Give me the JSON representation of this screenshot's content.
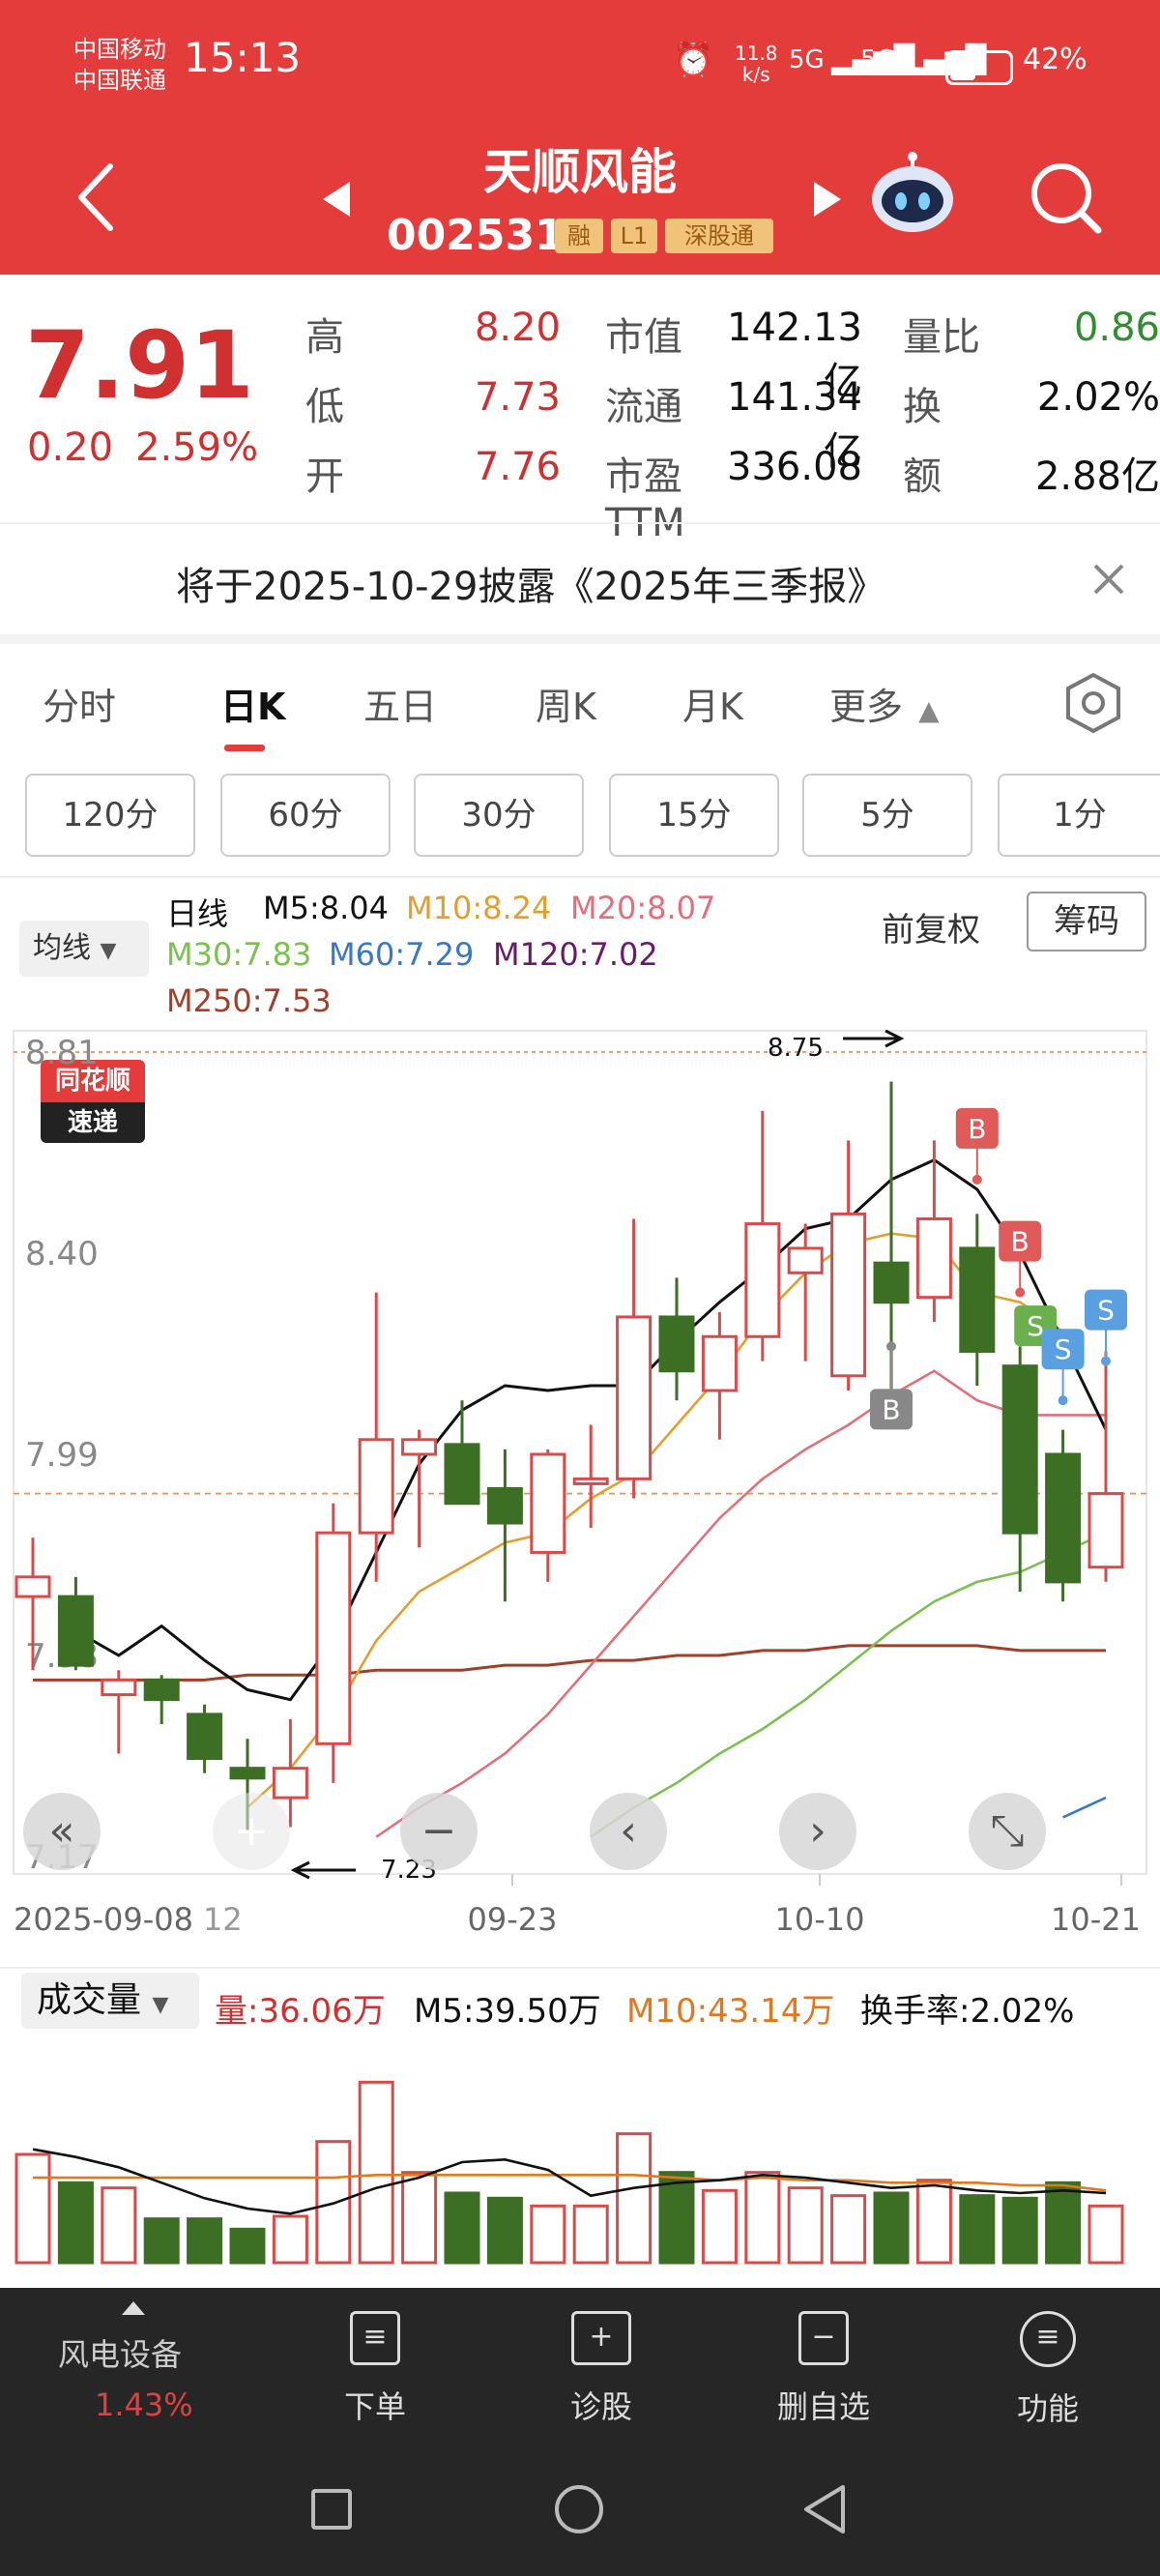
{
  "status_bar": {
    "carrier1": "中国移动",
    "carrier2": "中国联通",
    "time": "15:13",
    "net_speed_top": "11.8",
    "net_speed_bot": "k/s",
    "signal1": "5G",
    "signal2": "5G",
    "battery": "42%"
  },
  "header": {
    "title": "天顺风能",
    "code": "002531",
    "tags": [
      "融",
      "L1",
      "深股通"
    ]
  },
  "quote": {
    "price": "7.91",
    "change": "0.20",
    "change_pct": "2.59%",
    "rows": [
      {
        "l1": "高",
        "v1": "8.20",
        "l2": "市值",
        "v2": "142.13亿",
        "l3": "量比",
        "v3": "0.86"
      },
      {
        "l1": "低",
        "v1": "7.73",
        "l2": "流通",
        "v2": "141.34亿",
        "l3": "换",
        "v3": "2.02%"
      },
      {
        "l1": "开",
        "v1": "7.76",
        "l2": "市盈TTM",
        "v2": "336.08",
        "l3": "额",
        "v3": "2.88亿"
      }
    ]
  },
  "notice": {
    "logo_top": "同花顺",
    "logo_bottom": "速递",
    "text": "将于2025-10-29披露《2025年三季报》"
  },
  "tabs": [
    "分时",
    "日K",
    "五日",
    "周K",
    "月K",
    "更多"
  ],
  "minute_buttons": [
    "120分",
    "60分",
    "30分",
    "15分",
    "5分",
    "1分"
  ],
  "legend": {
    "selector": "均线",
    "period": "日线",
    "m5": "M5:8.04",
    "m10": "M10:8.24",
    "m20": "M20:8.07",
    "m30": "M30:7.83",
    "m60": "M60:7.29",
    "m120": "M120:7.02",
    "m250": "M250:7.53",
    "restore": "前复权",
    "chips": "筹码"
  },
  "colors": {
    "up": "#d94b4b",
    "down": "#3c6e24",
    "m5": "#111111",
    "m10": "#e0a030",
    "m20": "#e0707a",
    "m30": "#7cc050",
    "m60": "#3a78c0",
    "m120": "#6a1a6a",
    "m250": "#a0402a"
  },
  "chart_data": {
    "type": "candlestick",
    "ylim": [
      7.17,
      8.81
    ],
    "y_ticks": [
      "8.81",
      "8.40",
      "7.99",
      "7.58",
      "7.17"
    ],
    "x_labels": [
      "2025-09-08",
      "12",
      "09-23",
      "10-10",
      "10-21"
    ],
    "current_price_line": 7.91,
    "high_marker": "8.75",
    "low_marker": "7.23",
    "candles": [
      {
        "o": 7.7,
        "h": 7.82,
        "l": 7.55,
        "c": 7.74
      },
      {
        "o": 7.7,
        "h": 7.74,
        "l": 7.55,
        "c": 7.56
      },
      {
        "o": 7.5,
        "h": 7.55,
        "l": 7.38,
        "c": 7.53
      },
      {
        "o": 7.53,
        "h": 7.54,
        "l": 7.44,
        "c": 7.49
      },
      {
        "o": 7.46,
        "h": 7.48,
        "l": 7.34,
        "c": 7.37
      },
      {
        "o": 7.35,
        "h": 7.41,
        "l": 7.22,
        "c": 7.33
      },
      {
        "o": 7.29,
        "h": 7.45,
        "l": 7.23,
        "c": 7.35
      },
      {
        "o": 7.4,
        "h": 7.89,
        "l": 7.32,
        "c": 7.83
      },
      {
        "o": 7.83,
        "h": 8.32,
        "l": 7.73,
        "c": 8.02
      },
      {
        "o": 7.99,
        "h": 8.04,
        "l": 7.8,
        "c": 8.02
      },
      {
        "o": 8.01,
        "h": 8.1,
        "l": 7.92,
        "c": 7.89
      },
      {
        "o": 7.92,
        "h": 8.0,
        "l": 7.69,
        "c": 7.85
      },
      {
        "o": 7.79,
        "h": 8.0,
        "l": 7.73,
        "c": 7.99
      },
      {
        "o": 7.93,
        "h": 8.05,
        "l": 7.84,
        "c": 7.94
      },
      {
        "o": 7.94,
        "h": 8.47,
        "l": 7.9,
        "c": 8.27
      },
      {
        "o": 8.27,
        "h": 8.35,
        "l": 8.1,
        "c": 8.16
      },
      {
        "o": 8.12,
        "h": 8.28,
        "l": 8.02,
        "c": 8.23
      },
      {
        "o": 8.23,
        "h": 8.69,
        "l": 8.18,
        "c": 8.46
      },
      {
        "o": 8.36,
        "h": 8.46,
        "l": 8.18,
        "c": 8.41
      },
      {
        "o": 8.15,
        "h": 8.63,
        "l": 8.12,
        "c": 8.48
      },
      {
        "o": 8.38,
        "h": 8.75,
        "l": 8.1,
        "c": 8.3
      },
      {
        "o": 8.31,
        "h": 8.63,
        "l": 8.26,
        "c": 8.47
      },
      {
        "o": 8.41,
        "h": 8.48,
        "l": 8.13,
        "c": 8.2
      },
      {
        "o": 8.17,
        "h": 8.21,
        "l": 7.71,
        "c": 7.83
      },
      {
        "o": 7.99,
        "h": 8.04,
        "l": 7.69,
        "c": 7.73
      },
      {
        "o": 7.76,
        "h": 8.2,
        "l": 7.73,
        "c": 7.91
      }
    ],
    "ma5": [
      null,
      7.63,
      7.58,
      7.64,
      7.57,
      7.51,
      7.49,
      7.61,
      7.79,
      7.97,
      8.08,
      8.13,
      8.12,
      8.13,
      8.13,
      8.22,
      8.3,
      8.37,
      8.45,
      8.47,
      8.55,
      8.59,
      8.53,
      8.4,
      8.22,
      8.04
    ],
    "ma10": [
      null,
      null,
      null,
      null,
      null,
      7.27,
      7.35,
      7.46,
      7.61,
      7.71,
      7.76,
      7.81,
      7.83,
      7.9,
      7.95,
      8.05,
      8.15,
      8.27,
      8.36,
      8.42,
      8.44,
      8.43,
      8.32,
      8.3,
      8.24
    ],
    "ma20": [
      null,
      null,
      null,
      null,
      null,
      null,
      null,
      null,
      7.21,
      7.27,
      7.32,
      7.38,
      7.46,
      7.56,
      7.66,
      7.76,
      7.86,
      7.94,
      8.0,
      8.05,
      8.11,
      8.16,
      8.1,
      8.07,
      8.07,
      8.07
    ],
    "ma30": [
      null,
      null,
      null,
      null,
      null,
      null,
      null,
      null,
      null,
      null,
      null,
      null,
      null,
      7.21,
      7.27,
      7.32,
      7.38,
      7.43,
      7.49,
      7.56,
      7.63,
      7.69,
      7.73,
      7.75,
      7.79,
      7.83
    ],
    "ma60": [
      null,
      null,
      null,
      null,
      null,
      null,
      null,
      null,
      null,
      null,
      null,
      null,
      null,
      null,
      null,
      null,
      null,
      null,
      null,
      null,
      null,
      null,
      null,
      null,
      7.25,
      7.29
    ],
    "ma250": [
      7.53,
      7.53,
      7.53,
      7.53,
      7.53,
      7.54,
      7.54,
      7.54,
      7.55,
      7.55,
      7.55,
      7.56,
      7.56,
      7.57,
      7.57,
      7.58,
      7.58,
      7.59,
      7.59,
      7.6,
      7.6,
      7.6,
      7.6,
      7.59,
      7.59,
      7.59
    ],
    "trade_marks": [
      {
        "day": 20,
        "label": "B",
        "price": 8.21,
        "color": "#888888",
        "pos": "below"
      },
      {
        "day": 22,
        "label": "B",
        "price": 8.55,
        "color": "#e05a5a",
        "pos": "above"
      },
      {
        "day": 23,
        "label": "B",
        "price": 8.32,
        "color": "#e05a5a",
        "pos": "above"
      },
      {
        "day": 23,
        "label": "S",
        "price": 8.25,
        "color": "#6ab04c",
        "pos": "right"
      },
      {
        "day": 24,
        "label": "S",
        "price": 8.1,
        "color": "#5aa0e0",
        "pos": "above"
      },
      {
        "day": 25,
        "label": "S",
        "price": 8.18,
        "color": "#5aa0e0",
        "pos": "above"
      }
    ],
    "volume": {
      "label": "成交量",
      "current": "量:36.06万",
      "m5": "M5:39.50万",
      "m10": "M10:43.14万",
      "turnover": "换手率:2.02%",
      "values": [
        42,
        31,
        29,
        17,
        17,
        13,
        18,
        47,
        70,
        35,
        27,
        25,
        22,
        22,
        50,
        35,
        28,
        35,
        29,
        26,
        27,
        32,
        26,
        25,
        31,
        22
      ],
      "ma5": [
        44,
        41,
        37,
        31,
        25,
        21,
        19,
        23,
        29,
        33,
        39,
        40,
        36,
        26,
        29,
        31,
        32,
        34,
        33,
        31,
        29,
        30,
        28,
        27,
        28,
        27
      ],
      "ma10": [
        33,
        33,
        33,
        33,
        33,
        33,
        33,
        33,
        34,
        34,
        34,
        34,
        34,
        34,
        34,
        33,
        32,
        33,
        32,
        32,
        31,
        31,
        31,
        30,
        30,
        28
      ],
      "max": 75
    }
  },
  "chart_nav_buttons": [
    "«",
    "+",
    "−",
    "‹",
    "›",
    "⤡"
  ],
  "bottom_nav": {
    "sector": "风电设备",
    "sector_change": "1.43%",
    "items": [
      "下单",
      "诊股",
      "删自选",
      "功能"
    ]
  }
}
